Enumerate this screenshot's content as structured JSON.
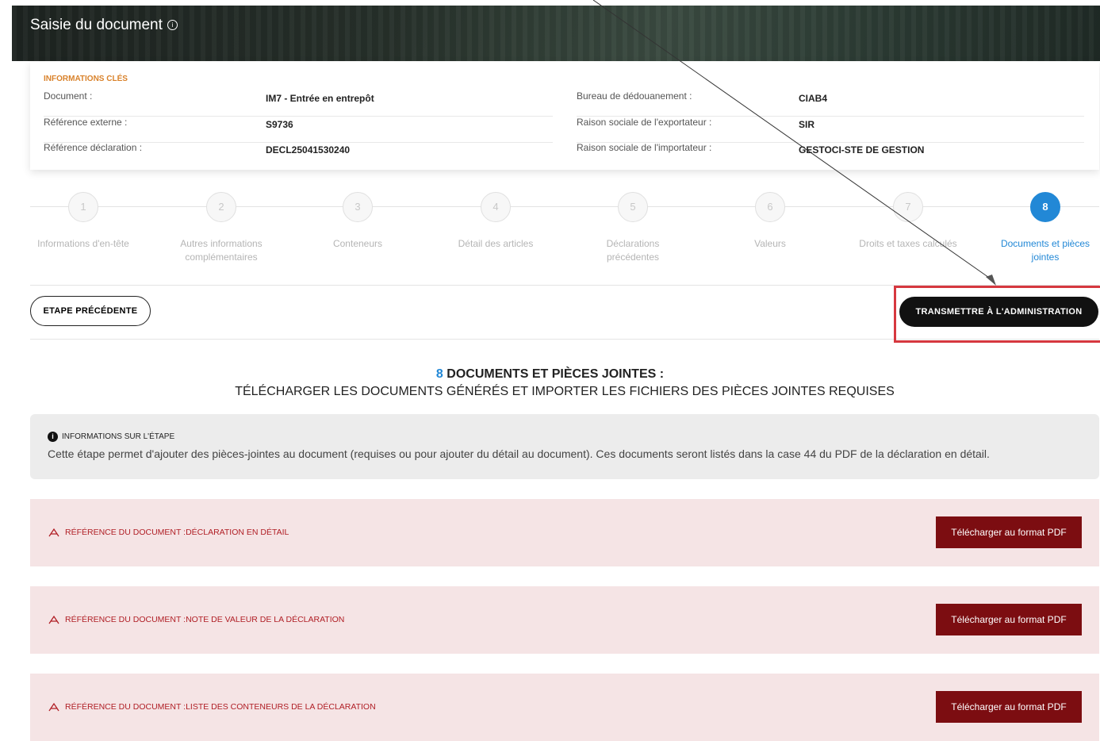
{
  "header": {
    "title": "Saisie du document",
    "info_icon": "info-circle-icon"
  },
  "info": {
    "heading": "INFORMATIONS CLÉS",
    "left": [
      {
        "label": "Document :",
        "value": "IM7 - Entrée en entrepôt"
      },
      {
        "label": "Référence externe :",
        "value": "S9736"
      },
      {
        "label": "Référence déclaration :",
        "value": "DECL25041530240"
      }
    ],
    "right": [
      {
        "label": "Bureau de dédouanement :",
        "value": "CIAB4"
      },
      {
        "label": "Raison sociale de l'exportateur :",
        "value": "SIR"
      },
      {
        "label": "Raison sociale de l'importateur :",
        "value": "GESTOCI-STE DE GESTION"
      }
    ]
  },
  "steps": [
    {
      "num": "1",
      "label": "Informations d'en-tête"
    },
    {
      "num": "2",
      "label": "Autres informations complémentaires"
    },
    {
      "num": "3",
      "label": "Conteneurs"
    },
    {
      "num": "4",
      "label": "Détail des articles"
    },
    {
      "num": "5",
      "label": "Déclarations précédentes"
    },
    {
      "num": "6",
      "label": "Valeurs"
    },
    {
      "num": "7",
      "label": "Droits et taxes calculés"
    },
    {
      "num": "8",
      "label": "Documents et pièces jointes",
      "active": true
    }
  ],
  "actions": {
    "prev_label": "ETAPE PRÉCÉDENTE",
    "submit_label": "TRANSMETTRE À L'ADMINISTRATION"
  },
  "section": {
    "number": "8",
    "title": " DOCUMENTS ET PIÈCES JOINTES :",
    "subtitle": "TÉLÉCHARGER LES DOCUMENTS GÉNÉRÉS ET IMPORTER LES FICHIERS DES PIÈCES JOINTES REQUISES"
  },
  "step_info": {
    "heading": "INFORMATIONS SUR L'ÉTAPE",
    "text": "Cette étape permet d'ajouter des pièces-jointes au document (requises ou pour ajouter du détail au document). Ces documents seront listés dans la case 44 du PDF de la déclaration en détail."
  },
  "documents": [
    {
      "label": "RÉFÉRENCE DU DOCUMENT :DÉCLARATION EN DÉTAIL",
      "button": "Télécharger au format PDF"
    },
    {
      "label": "RÉFÉRENCE DU DOCUMENT :NOTE DE VALEUR DE LA DÉCLARATION",
      "button": "Télécharger au format PDF"
    },
    {
      "label": "RÉFÉRENCE DU DOCUMENT :LISTE DES CONTENEURS DE LA DÉCLARATION",
      "button": "Télécharger au format PDF"
    }
  ],
  "colors": {
    "accent": "#2288d6",
    "doc_button": "#7c0d11",
    "doc_row_bg": "#f5e4e5",
    "highlight": "#d6383f"
  }
}
